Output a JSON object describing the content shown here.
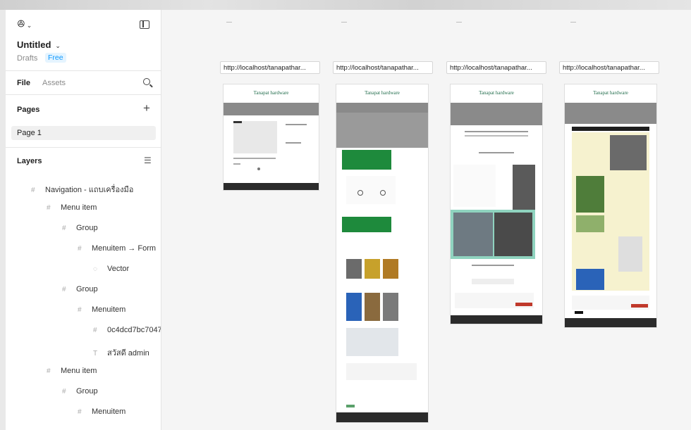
{
  "panel": {
    "file_title": "Untitled",
    "drafts": "Drafts",
    "plan_badge": "Free",
    "tabs": {
      "file": "File",
      "assets": "Assets"
    },
    "pages_heading": "Pages",
    "pages": [
      "Page 1"
    ],
    "layers_heading": "Layers",
    "layers": [
      {
        "label": "Navigation - แถบเครื่องมือ",
        "icon": "frame-icon"
      },
      {
        "label": "Menu item",
        "icon": "frame-icon"
      },
      {
        "label": "Group",
        "icon": "frame-icon"
      },
      {
        "label": "Menuitem → Form",
        "icon": "frame-icon"
      },
      {
        "label": "Vector",
        "icon": "vector-icon"
      },
      {
        "label": "Group",
        "icon": "frame-icon"
      },
      {
        "label": "Menuitem",
        "icon": "frame-icon"
      },
      {
        "label": "0c4dcd7bc7047",
        "icon": "frame-icon"
      },
      {
        "label": "สวัสดี admin",
        "icon": "text-icon"
      },
      {
        "label": "Menu item",
        "icon": "frame-icon"
      },
      {
        "label": "Group",
        "icon": "frame-icon"
      },
      {
        "label": "Menuitem",
        "icon": "frame-icon"
      }
    ]
  },
  "canvas": {
    "frames": [
      {
        "url": "http://localhost/tanapathar...",
        "site_title": "Tanapat hardware"
      },
      {
        "url": "http://localhost/tanapathar...",
        "site_title": "Tanapat hardware"
      },
      {
        "url": "http://localhost/tanapathar...",
        "site_title": "Tanapat hardware"
      },
      {
        "url": "http://localhost/tanapathar...",
        "site_title": "Tanapat hardware"
      }
    ]
  },
  "colors": {
    "accent": "#0d99ff",
    "site_green": "#1e8a3c",
    "site_dark": "#2b2b2b",
    "site_teal": "#8fd3bf",
    "site_cream": "#f6f2cf"
  }
}
